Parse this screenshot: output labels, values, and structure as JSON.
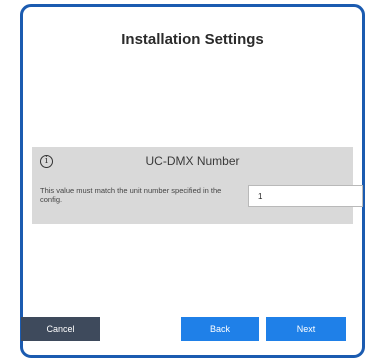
{
  "dialog": {
    "title": "Installation Settings"
  },
  "setting": {
    "info_icon": "info-icon",
    "title": "UC-DMX Number",
    "description": "This value must match the unit number specified in the config.",
    "value": "1"
  },
  "buttons": {
    "cancel": "Cancel",
    "back": "Back",
    "next": "Next"
  },
  "colors": {
    "frame_border": "#1b5bb0",
    "panel_bg": "#d9d9d9",
    "primary_button": "#1f80e8",
    "secondary_button": "#3e4a5c"
  }
}
